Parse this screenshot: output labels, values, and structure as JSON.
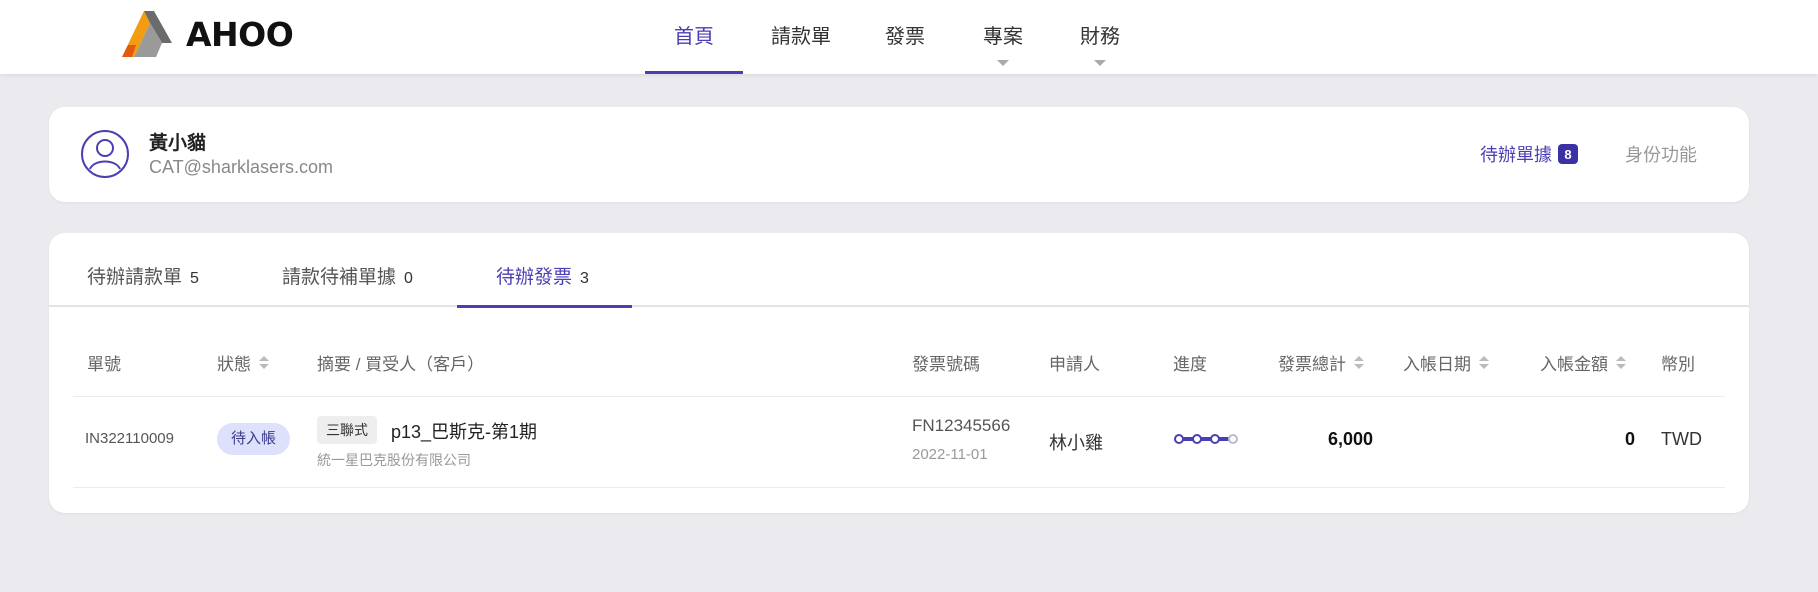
{
  "header": {
    "brand": "AHOO",
    "nav": [
      {
        "label": "首頁",
        "active": true,
        "has_dropdown": false
      },
      {
        "label": "請款單",
        "active": false,
        "has_dropdown": false
      },
      {
        "label": "發票",
        "active": false,
        "has_dropdown": false
      },
      {
        "label": "專案",
        "active": false,
        "has_dropdown": true
      },
      {
        "label": "財務",
        "active": false,
        "has_dropdown": true
      }
    ]
  },
  "profile": {
    "name": "黃小貓",
    "email": "CAT@sharklasers.com",
    "pending_label": "待辦單據",
    "pending_count": "8",
    "role_label": "身份功能"
  },
  "tabs": [
    {
      "label": "待辦請款單",
      "count": "5",
      "active": false
    },
    {
      "label": "請款待補單據",
      "count": "0",
      "active": false
    },
    {
      "label": "待辦發票",
      "count": "3",
      "active": true
    }
  ],
  "table": {
    "columns": [
      {
        "label": "單號",
        "sortable": false
      },
      {
        "label": "狀態",
        "sortable": true
      },
      {
        "label": "摘要 / 買受人（客戶）",
        "sortable": false
      },
      {
        "label": "發票號碼",
        "sortable": false
      },
      {
        "label": "申請人",
        "sortable": false
      },
      {
        "label": "進度",
        "sortable": false
      },
      {
        "label": "發票總計",
        "sortable": true
      },
      {
        "label": "入帳日期",
        "sortable": true
      },
      {
        "label": "入帳金額",
        "sortable": true
      },
      {
        "label": "幣別",
        "sortable": false
      }
    ],
    "rows": [
      {
        "doc_no": "IN322110009",
        "status": "待入帳",
        "type_tag": "三聯式",
        "summary": "p13_巴斯克-第1期",
        "client": "統一星巴克股份有限公司",
        "invoice_no": "FN12345566",
        "invoice_date": "2022-11-01",
        "applicant": "林小雞",
        "progress": {
          "completed_steps": 3,
          "total_steps": 4
        },
        "total": "6,000",
        "posting_date": "",
        "posted_amount": "0",
        "currency": "TWD"
      }
    ]
  },
  "colors": {
    "accent": "#4a3fb3",
    "badge": "#3b31a6",
    "status_pill_bg": "#dde1fb",
    "page_bg": "#ebebef",
    "logo_orange": "#f39c12",
    "logo_gray": "#555555"
  }
}
